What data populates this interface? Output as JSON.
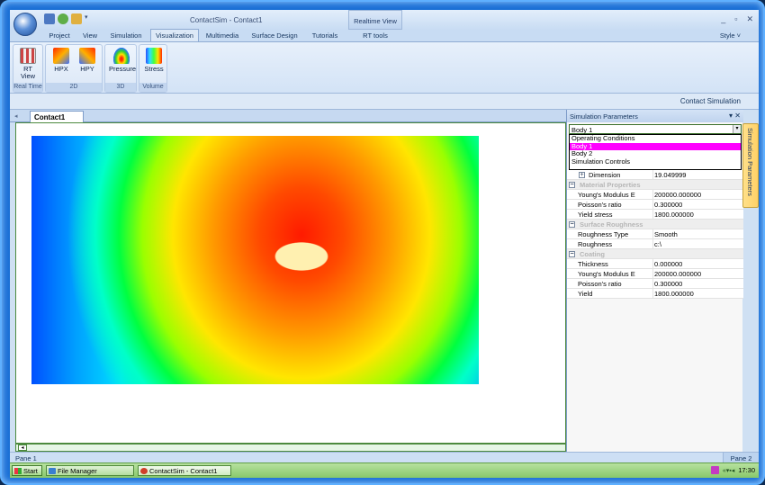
{
  "app": {
    "title": "ContactSim - Contact1",
    "contextual_tab": "Realtime View",
    "window_controls": [
      "_",
      "▫",
      "✕"
    ]
  },
  "tabs": [
    "Project",
    "View",
    "Simulation",
    "Visualization",
    "Multimedia",
    "Surface Design",
    "Tutorials",
    "RT tools"
  ],
  "active_tab": "Visualization",
  "style_label": "Style ˅",
  "ribbon": {
    "groups": [
      {
        "caption": "Real Time",
        "buttons": [
          {
            "label": "RT\nView",
            "icon": "rt-view-icon"
          }
        ]
      },
      {
        "caption": "2D",
        "buttons": [
          {
            "label": "HPX",
            "icon": "hpx-icon"
          },
          {
            "label": "HPY",
            "icon": "hpy-icon"
          }
        ]
      },
      {
        "caption": "3D",
        "buttons": [
          {
            "label": "Pressure",
            "icon": "pressure-icon"
          }
        ]
      },
      {
        "caption": "Volume",
        "buttons": [
          {
            "label": "Stress",
            "icon": "stress-icon"
          }
        ]
      }
    ]
  },
  "subbar_label": "Contact Simulation",
  "doc_tab": "Contact1",
  "panel": {
    "title": "Simulation Parameters",
    "controls": "▾ ✕",
    "combo_value": "Body 1",
    "dropdown": [
      "Operating Conditions",
      "Body 1",
      "Body 2",
      "Simulation Controls"
    ],
    "dropdown_selected": 1,
    "dimension": {
      "name": "Dimension",
      "value": "19.049999"
    },
    "categories": [
      {
        "name": "Material Properties",
        "rows": [
          {
            "name": "Young's Modulus E",
            "value": "200000.000000"
          },
          {
            "name": "Poisson's ratio",
            "value": "0.300000"
          },
          {
            "name": "Yield stress",
            "value": "1800.000000"
          }
        ]
      },
      {
        "name": "Surface Roughness",
        "rows": [
          {
            "name": "Roughness Type",
            "value": "Smooth"
          },
          {
            "name": "Roughness",
            "value": "c:\\"
          }
        ]
      },
      {
        "name": "Coating",
        "rows": [
          {
            "name": "Thickness",
            "value": "0.000000"
          },
          {
            "name": "Young's Modulus E",
            "value": "200000.000000"
          },
          {
            "name": "Poisson's ratio",
            "value": "0.300000"
          },
          {
            "name": "Yield",
            "value": "1800.000000"
          }
        ]
      }
    ]
  },
  "side_tab": "Simulation Parameters",
  "status": {
    "left": "Pane 1",
    "right": "Pane 2"
  },
  "taskbar": {
    "start": "Start",
    "items": [
      "File Manager",
      "ContactSim - Contact1"
    ],
    "time": "17:30",
    "tray": "«▾▪◂"
  },
  "colors": {
    "heatmap_peak": "#ff1a00",
    "heatmap_low": "#0050ff",
    "contact_patch": "#fff0b0",
    "taskbar": "#88c86a"
  }
}
